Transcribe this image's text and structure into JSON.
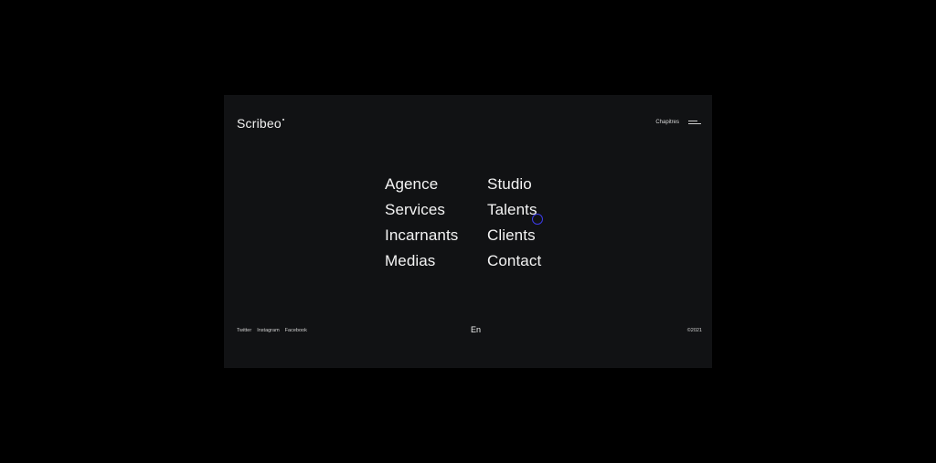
{
  "brand": {
    "name": "Scribeo"
  },
  "header": {
    "chapters_label": "Chapitres",
    "menu_icon": "hamburger-icon"
  },
  "nav": {
    "items": [
      {
        "label": "Agence"
      },
      {
        "label": "Studio"
      },
      {
        "label": "Services"
      },
      {
        "label": "Talents"
      },
      {
        "label": "Incarnants"
      },
      {
        "label": "Clients"
      },
      {
        "label": "Medias"
      },
      {
        "label": "Contact"
      }
    ]
  },
  "footer": {
    "socials": [
      {
        "label": "Twitter"
      },
      {
        "label": "Instagram"
      },
      {
        "label": "Facebook"
      }
    ],
    "language": "En",
    "copyright": "©2021"
  },
  "colors": {
    "page_background": "#000000",
    "panel_background": "#111214",
    "text": "#f4f4f4",
    "cursor_accent": "#3b3be8"
  }
}
